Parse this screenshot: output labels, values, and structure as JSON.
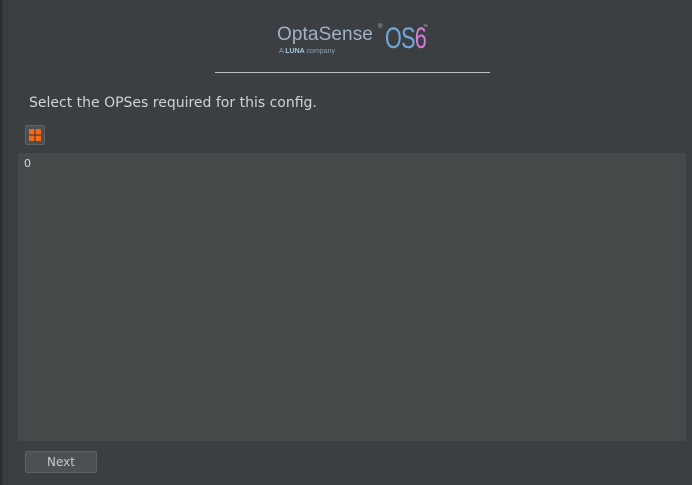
{
  "logo": {
    "brand": "OptaSense",
    "registered_mark": "®",
    "tagline_prefix": "A ",
    "tagline_luna": "LUNA",
    "tagline_suffix": " company",
    "product_os": "OS",
    "product_six": "6",
    "trademark_mark": "™"
  },
  "instruction": "Select the OPSes required for this config.",
  "toolbar": {
    "grid_toggle_icon": "grid-four-squares-icon"
  },
  "list": {
    "items": [
      "0"
    ]
  },
  "footer": {
    "next_label": "Next"
  },
  "colors": {
    "background": "#3c3f41",
    "panel": "#45494a",
    "accent_orange": "#f26b1d",
    "logo_blue": "#6fa8dc",
    "logo_pink": "#d97bd8"
  }
}
